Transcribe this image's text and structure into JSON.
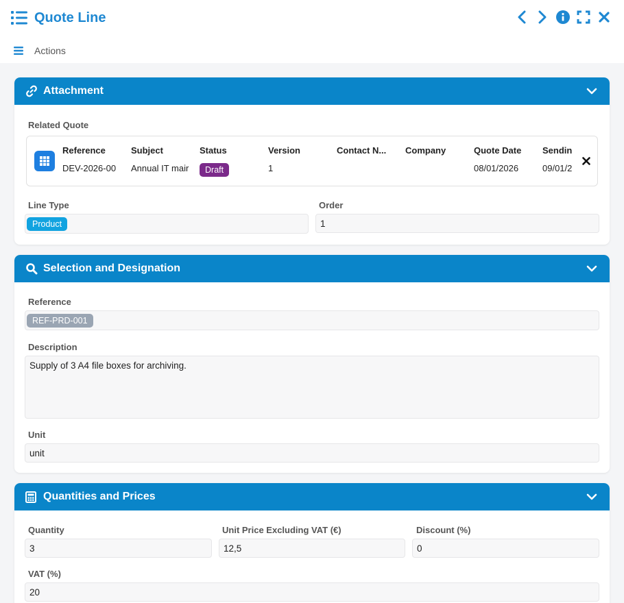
{
  "window": {
    "title": "Quote Line",
    "actions_label": "Actions"
  },
  "colors": {
    "accent": "#0a85c9",
    "title_blue": "#1e88d2",
    "draft_badge": "#7b2a8a",
    "product_badge": "#12a3e0",
    "reference_badge": "#9aa5b3"
  },
  "attachment": {
    "title": "Attachment",
    "related_quote_label": "Related Quote",
    "columns": [
      {
        "header": "Reference",
        "value": "DEV-2026-00"
      },
      {
        "header": "Subject",
        "value": "Annual IT mair"
      },
      {
        "header": "Status",
        "value": "Draft"
      },
      {
        "header": "Version",
        "value": "1"
      },
      {
        "header": "Contact N...",
        "value": ""
      },
      {
        "header": "Company",
        "value": ""
      },
      {
        "header": "Quote Date",
        "value": "08/01/2026"
      },
      {
        "header": "Sendin",
        "value": "09/01/2"
      }
    ],
    "line_type_label": "Line Type",
    "line_type_value": "Product",
    "order_label": "Order",
    "order_value": "1"
  },
  "selection": {
    "title": "Selection and Designation",
    "reference_label": "Reference",
    "reference_value": "REF-PRD-001",
    "description_label": "Description",
    "description_value": "Supply of 3 A4 file boxes for archiving.",
    "unit_label": "Unit",
    "unit_value": "unit"
  },
  "quantities": {
    "title": "Quantities and Prices",
    "quantity_label": "Quantity",
    "quantity_value": "3",
    "unit_price_label": "Unit Price Excluding VAT (€)",
    "unit_price_value": "12,5",
    "discount_label": "Discount (%)",
    "discount_value": "0",
    "vat_label": "VAT (%)",
    "vat_value": "20"
  }
}
